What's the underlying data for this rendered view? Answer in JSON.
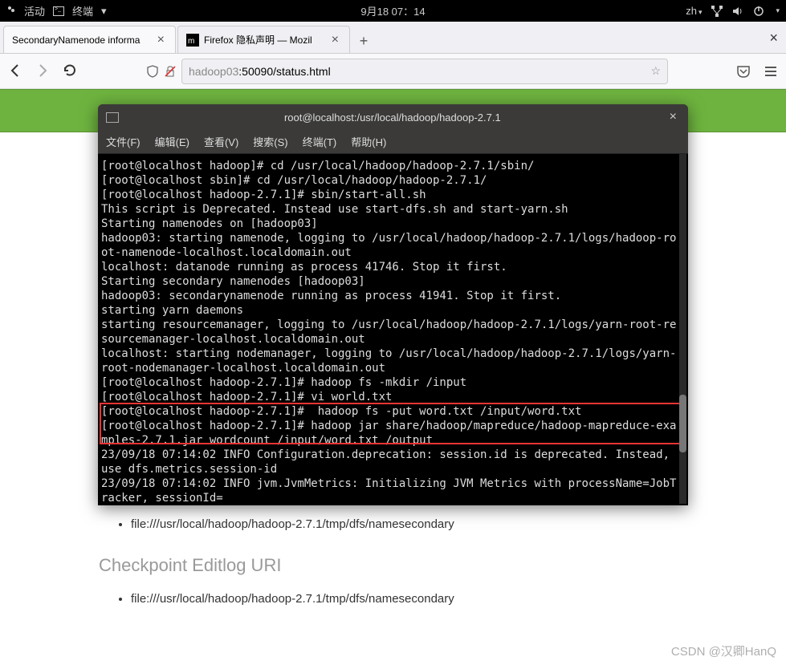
{
  "gnome": {
    "activities": "活动",
    "terminal_label": "终端",
    "datetime": "9月18  07：14",
    "ime": "zh"
  },
  "browser": {
    "tabs": [
      {
        "label": "SecondaryNamenode informa",
        "active": true
      },
      {
        "label": "Firefox 隐私声明 — Mozil",
        "active": false
      }
    ],
    "address_host": "hadoop03",
    "address_rest": ":50090/status.html"
  },
  "terminal": {
    "title": "root@localhost:/usr/local/hadoop/hadoop-2.7.1",
    "menu": {
      "file": "文件(F)",
      "edit": "编辑(E)",
      "view": "查看(V)",
      "search": "搜索(S)",
      "terminal": "终端(T)",
      "help": "帮助(H)"
    },
    "output": "[root@localhost hadoop]# cd /usr/local/hadoop/hadoop-2.7.1/sbin/\n[root@localhost sbin]# cd /usr/local/hadoop/hadoop-2.7.1/\n[root@localhost hadoop-2.7.1]# sbin/start-all.sh\nThis script is Deprecated. Instead use start-dfs.sh and start-yarn.sh\nStarting namenodes on [hadoop03]\nhadoop03: starting namenode, logging to /usr/local/hadoop/hadoop-2.7.1/logs/hadoop-root-namenode-localhost.localdomain.out\nlocalhost: datanode running as process 41746. Stop it first.\nStarting secondary namenodes [hadoop03]\nhadoop03: secondarynamenode running as process 41941. Stop it first.\nstarting yarn daemons\nstarting resourcemanager, logging to /usr/local/hadoop/hadoop-2.7.1/logs/yarn-root-resourcemanager-localhost.localdomain.out\nlocalhost: starting nodemanager, logging to /usr/local/hadoop/hadoop-2.7.1/logs/yarn-root-nodemanager-localhost.localdomain.out\n[root@localhost hadoop-2.7.1]# hadoop fs -mkdir /input\n[root@localhost hadoop-2.7.1]# vi world.txt\n[root@localhost hadoop-2.7.1]#  hadoop fs -put word.txt /input/word.txt\n[root@localhost hadoop-2.7.1]# hadoop jar share/hadoop/mapreduce/hadoop-mapreduce-examples-2.7.1.jar wordcount /input/word.txt /output\n23/09/18 07:14:02 INFO Configuration.deprecation: session.id is deprecated. Instead, use dfs.metrics.session-id\n23/09/18 07:14:02 INFO jvm.JvmMetrics: Initializing JVM Metrics with processName=JobTracker, sessionId="
  },
  "page": {
    "checkpoint_items": [
      "file:///usr/local/hadoop/hadoop-2.7.1/tmp/dfs/namesecondary"
    ],
    "editlog_heading": "Checkpoint Editlog URI",
    "editlog_items": [
      "file:///usr/local/hadoop/hadoop-2.7.1/tmp/dfs/namesecondary"
    ]
  },
  "watermark": "CSDN @汉卿HanQ"
}
